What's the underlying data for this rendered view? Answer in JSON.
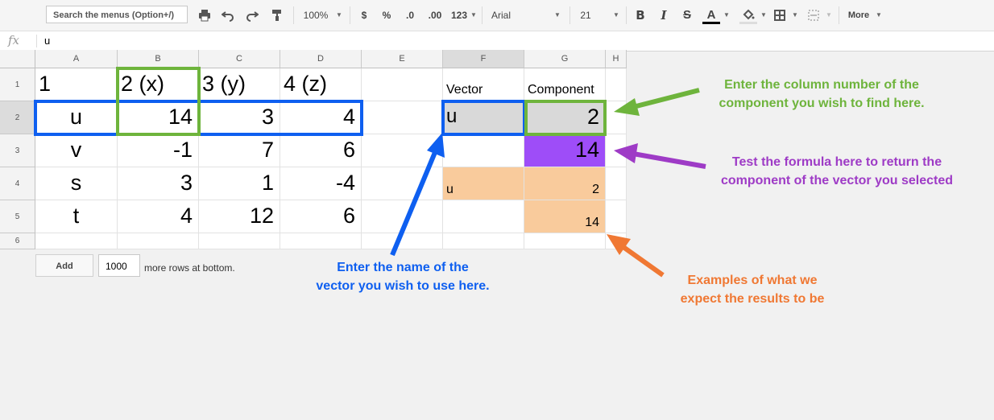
{
  "toolbar": {
    "search_placeholder": "Search the menus (Option+/)",
    "zoom": "100%",
    "currency": "$",
    "percent": "%",
    "decrease_decimal": ".0",
    "increase_decimal": ".00",
    "more_formats": "123",
    "font": "Arial",
    "font_size": "21",
    "bold": "B",
    "italic": "I",
    "strike": "S",
    "text_color": "A",
    "more": "More"
  },
  "formula_bar": {
    "fx": "fx",
    "value": "u"
  },
  "columns": [
    "A",
    "B",
    "C",
    "D",
    "E",
    "F",
    "G",
    "H"
  ],
  "rows": [
    "1",
    "2",
    "3",
    "4",
    "5",
    "6"
  ],
  "cells": {
    "A1": "1",
    "B1": "2 (x)",
    "C1": "3 (y)",
    "D1": "4 (z)",
    "F1": "Vector",
    "G1": "Component",
    "A2": "u",
    "B2": "14",
    "C2": "3",
    "D2": "4",
    "F2": "u",
    "G2": "2",
    "A3": "v",
    "B3": "-1",
    "C3": "7",
    "D3": "6",
    "G3": "14",
    "A4": "s",
    "B4": "3",
    "C4": "1",
    "D4": "-4",
    "F4": "u",
    "G4": "2",
    "A5": "t",
    "B5": "4",
    "C5": "12",
    "D5": "6",
    "G5": "14"
  },
  "footer": {
    "add_button": "Add",
    "rows_count": "1000",
    "rows_text": "more rows at bottom."
  },
  "annotations": {
    "green": "Enter the column number of the\ncomponent you wish to find here.",
    "purple": "Test the formula here to return the\ncomponent of the vector you selected",
    "blue": "Enter the name of the\nvector you wish to use here.",
    "orange": "Examples of what we\nexpect the results to be"
  },
  "colors": {
    "blue": "#0e5ff0",
    "green": "#6eb43c",
    "purple": "#9e3bc6",
    "orange": "#f07833",
    "highlight_purple": "#9e4df8",
    "peach": "#f9cb9c",
    "gray": "#d9d9d9"
  }
}
